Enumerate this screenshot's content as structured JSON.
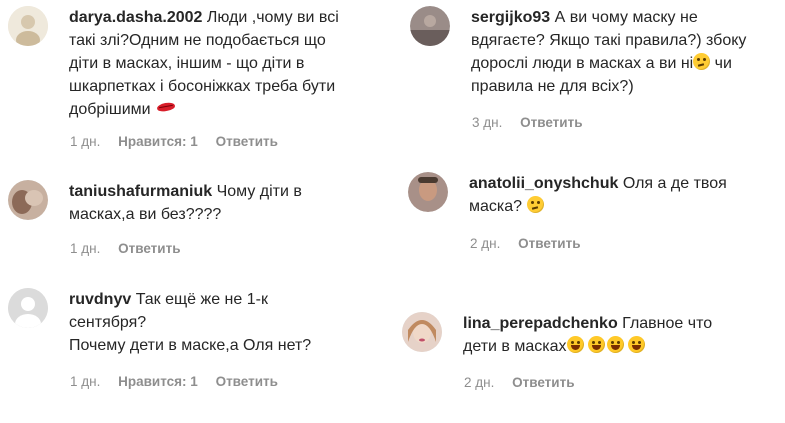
{
  "comments": [
    {
      "user": "darya.dasha.2002",
      "lines": [
        "Люди ,чому ви всі",
        "такі злі?Одним не подобається що",
        "діти в масках, іншим - що діти в",
        "шкарпетках і босоніжках треба бути",
        "добрішими"
      ],
      "emoji": "kiss-mark",
      "time": "1 дн.",
      "likes": "Нравится: 1",
      "reply": "Ответить",
      "avatar_color": "#e8e0cf"
    },
    {
      "user": "sergijko93",
      "lines": [
        "А ви чому маску не",
        "вдягаєте? Якщо такі правила?) збоку",
        "дорослі люди в масках а ви ні",
        "правила не для всіх?)"
      ],
      "line3_tail": " чи",
      "emoji": "thinking-face",
      "time": "3 дн.",
      "reply": "Ответить",
      "avatar_color": "#8a7a78"
    },
    {
      "user": "taniushafurmaniuk",
      "lines": [
        "Чому діти в",
        "масках,а ви без????"
      ],
      "time": "1 дн.",
      "reply": "Ответить",
      "avatar_color": "#b69a8a"
    },
    {
      "user": "anatolii_onyshchuk",
      "lines": [
        "Оля а де твоя",
        "маска?"
      ],
      "emoji": "thinking-face",
      "time": "2 дн.",
      "reply": "Ответить",
      "avatar_color": "#8a6a5a"
    },
    {
      "user": "ruvdnyv",
      "lines": [
        "Так ещё же не 1-к",
        "сентября?",
        "Почему дети в маске,а Оля нет?"
      ],
      "time": "1 дн.",
      "likes": "Нравится: 1",
      "reply": "Ответить",
      "avatar_color": "#dbdbdb"
    },
    {
      "user": "lina_perepadchenko",
      "lines": [
        "Главное что",
        "дети в масках"
      ],
      "emoji": "rolling-laughing-face",
      "time": "2 дн.",
      "reply": "Ответить",
      "avatar_color": "#c9a898"
    }
  ]
}
